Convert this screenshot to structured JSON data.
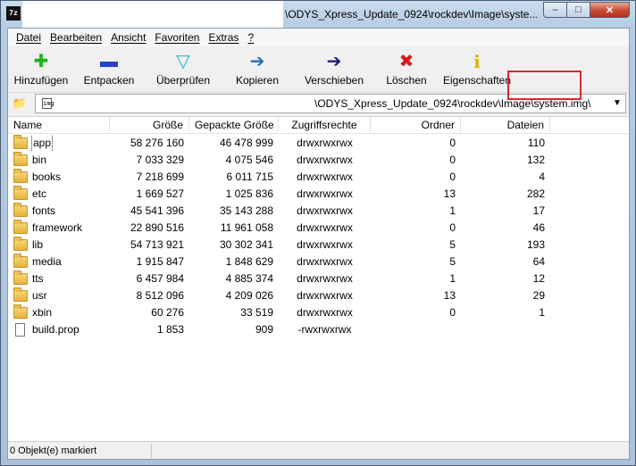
{
  "titlebar": {
    "app_icon_text": "7z",
    "title": "\\ODYS_Xpress_Update_0924\\rockdev\\Image\\syste..."
  },
  "window_buttons": {
    "minimize": "–",
    "maximize": "□",
    "close": "✕"
  },
  "menu": [
    {
      "label": "Datei"
    },
    {
      "label": "Bearbeiten"
    },
    {
      "label": "Ansicht"
    },
    {
      "label": "Favoriten"
    },
    {
      "label": "Extras"
    },
    {
      "label": "?"
    }
  ],
  "toolbar": [
    {
      "label": "Hinzufügen",
      "icon": "plus-icon",
      "glyph": "✚",
      "color": "#1fb31f"
    },
    {
      "label": "Entpacken",
      "icon": "minus-icon",
      "glyph": "▬",
      "color": "#2344c8"
    },
    {
      "label": "Überprüfen",
      "icon": "check-triangle-icon",
      "glyph": "▽",
      "color": "#1fb7c8"
    },
    {
      "label": "Kopieren",
      "icon": "copy-arrow-icon",
      "glyph": "➔",
      "color": "#2a6fb8"
    },
    {
      "label": "Verschieben",
      "icon": "move-arrow-icon",
      "glyph": "➔",
      "color": "#1c1c6e"
    },
    {
      "label": "Löschen",
      "icon": "delete-x-icon",
      "glyph": "✖",
      "color": "#d81b1b"
    },
    {
      "label": "Eigenschaften",
      "icon": "info-icon",
      "glyph": "i",
      "color": "#d8b400"
    }
  ],
  "address": {
    "path": "\\ODYS_Xpress_Update_0924\\rockdev\\Image\\system.img\\",
    "dropdown": "▼"
  },
  "columns": {
    "name": "Name",
    "size": "Größe",
    "packed": "Gepackte Größe",
    "attr": "Zugriffsrechte",
    "folders": "Ordner",
    "files": "Dateien"
  },
  "rows": [
    {
      "name": "app",
      "type": "folder",
      "size": "58 276 160",
      "packed": "46 478 999",
      "attr": "drwxrwxrwx",
      "folders": "0",
      "files": "110"
    },
    {
      "name": "bin",
      "type": "folder",
      "size": "7 033 329",
      "packed": "4 075 546",
      "attr": "drwxrwxrwx",
      "folders": "0",
      "files": "132"
    },
    {
      "name": "books",
      "type": "folder",
      "size": "7 218 699",
      "packed": "6 011 715",
      "attr": "drwxrwxrwx",
      "folders": "0",
      "files": "4"
    },
    {
      "name": "etc",
      "type": "folder",
      "size": "1 669 527",
      "packed": "1 025 836",
      "attr": "drwxrwxrwx",
      "folders": "13",
      "files": "282"
    },
    {
      "name": "fonts",
      "type": "folder",
      "size": "45 541 396",
      "packed": "35 143 288",
      "attr": "drwxrwxrwx",
      "folders": "1",
      "files": "17"
    },
    {
      "name": "framework",
      "type": "folder",
      "size": "22 890 516",
      "packed": "11 961 058",
      "attr": "drwxrwxrwx",
      "folders": "0",
      "files": "46"
    },
    {
      "name": "lib",
      "type": "folder",
      "size": "54 713 921",
      "packed": "30 302 341",
      "attr": "drwxrwxrwx",
      "folders": "5",
      "files": "193"
    },
    {
      "name": "media",
      "type": "folder",
      "size": "1 915 847",
      "packed": "1 848 629",
      "attr": "drwxrwxrwx",
      "folders": "5",
      "files": "64"
    },
    {
      "name": "tts",
      "type": "folder",
      "size": "6 457 984",
      "packed": "4 885 374",
      "attr": "drwxrwxrwx",
      "folders": "1",
      "files": "12"
    },
    {
      "name": "usr",
      "type": "folder",
      "size": "8 512 096",
      "packed": "4 209 026",
      "attr": "drwxrwxrwx",
      "folders": "13",
      "files": "29"
    },
    {
      "name": "xbin",
      "type": "folder",
      "size": "60 276",
      "packed": "33 519",
      "attr": "drwxrwxrwx",
      "folders": "0",
      "files": "1"
    },
    {
      "name": "build.prop",
      "type": "file",
      "size": "1 853",
      "packed": "909",
      "attr": "-rwxrwxrwx",
      "folders": "",
      "files": ""
    }
  ],
  "status": {
    "text": "0 Objekt(e) markiert"
  },
  "colors": {
    "highlight_box": "#e0242c",
    "title_bar": "#b6cce3"
  }
}
